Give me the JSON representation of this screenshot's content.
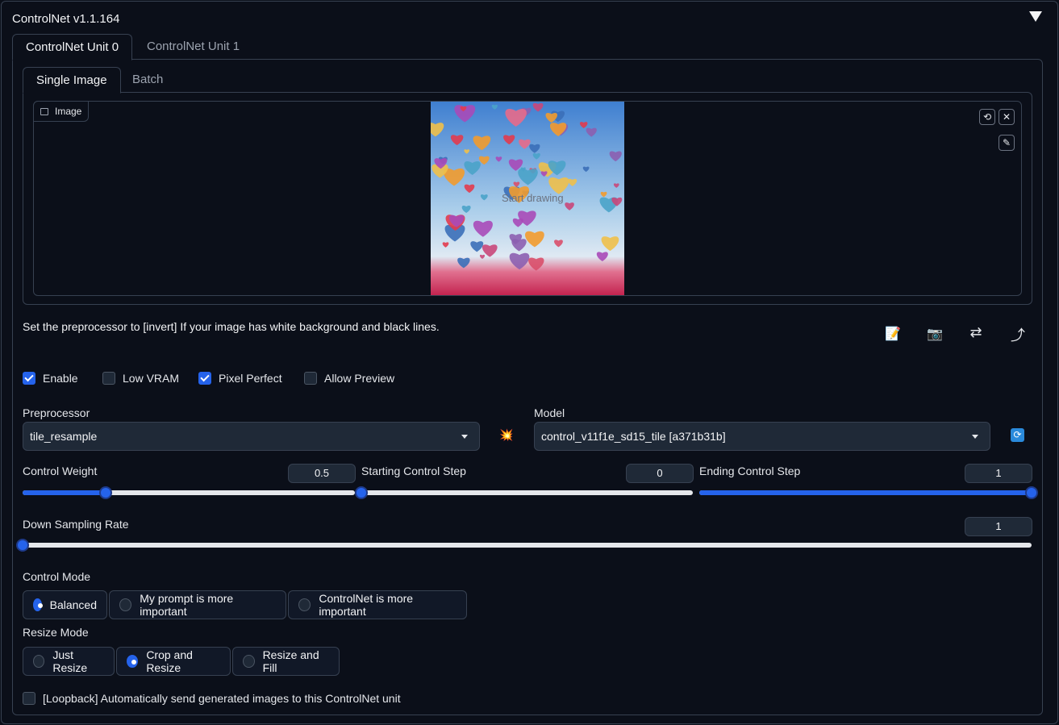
{
  "panel": {
    "title": "ControlNet v1.1.164"
  },
  "unit_tabs": [
    {
      "label": "ControlNet Unit 0"
    },
    {
      "label": "ControlNet Unit 1"
    }
  ],
  "image_tabs": [
    {
      "label": "Single Image"
    },
    {
      "label": "Batch"
    }
  ],
  "image": {
    "label": "Image",
    "overlay_text": "Start drawing"
  },
  "helper_text": "Set the preprocessor to [invert] If your image has white background and black lines.",
  "tools": {
    "edit": "📝",
    "camera": "📷",
    "swap": "⇄",
    "send": "⤴"
  },
  "checkboxes": [
    {
      "label": "Enable",
      "checked": true
    },
    {
      "label": "Low VRAM",
      "checked": false
    },
    {
      "label": "Pixel Perfect",
      "checked": true
    },
    {
      "label": "Allow Preview",
      "checked": false
    }
  ],
  "preprocessor": {
    "label": "Preprocessor",
    "value": "tile_resample",
    "run_icon": "💥"
  },
  "model": {
    "label": "Model",
    "value": "control_v11f1e_sd15_tile [a371b31b]",
    "refresh_icon": "🔄"
  },
  "sliders": {
    "control_weight": {
      "label": "Control Weight",
      "value": "0.5",
      "fraction": 0.25
    },
    "starting_step": {
      "label": "Starting Control Step",
      "value": "0",
      "fraction": 0.0
    },
    "ending_step": {
      "label": "Ending Control Step",
      "value": "1",
      "fraction": 1.0
    },
    "down_sampling": {
      "label": "Down Sampling Rate",
      "value": "1",
      "fraction": 0.0
    }
  },
  "control_mode": {
    "label": "Control Mode",
    "options": [
      "Balanced",
      "My prompt is more important",
      "ControlNet is more important"
    ],
    "selected": "Balanced"
  },
  "resize_mode": {
    "label": "Resize Mode",
    "options": [
      "Just Resize",
      "Crop and Resize",
      "Resize and Fill"
    ],
    "selected": "Crop and Resize"
  },
  "loopback": {
    "label": "[Loopback] Automatically send generated images to this ControlNet unit",
    "checked": false
  }
}
